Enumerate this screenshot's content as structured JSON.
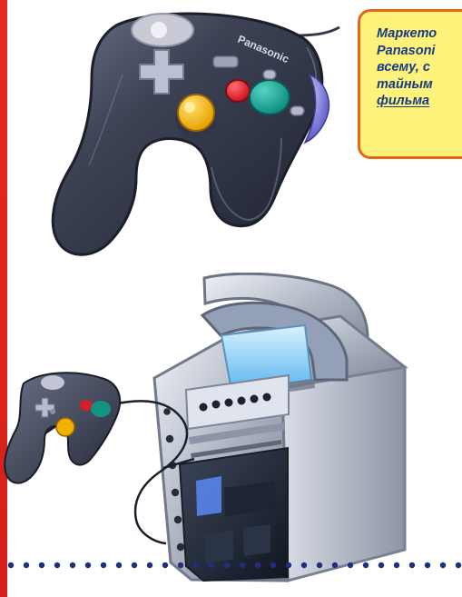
{
  "caption": {
    "lines": [
      "Маркето",
      "Panasoni",
      "всему, с",
      "тайным",
      "фильма"
    ]
  },
  "controller_label": {
    "brand": "Panasonic"
  },
  "colors": {
    "left_stripe": "#df261d",
    "caption_border": "#e46719",
    "caption_background": "#fff27b",
    "caption_text": "#173a86",
    "dot_color": "#1f2f7d"
  },
  "icons": {
    "controller_top": "gamecube-controller-icon",
    "console_setup": "panasonic-q-console-icon",
    "controller_small": "small-controller-icon"
  }
}
